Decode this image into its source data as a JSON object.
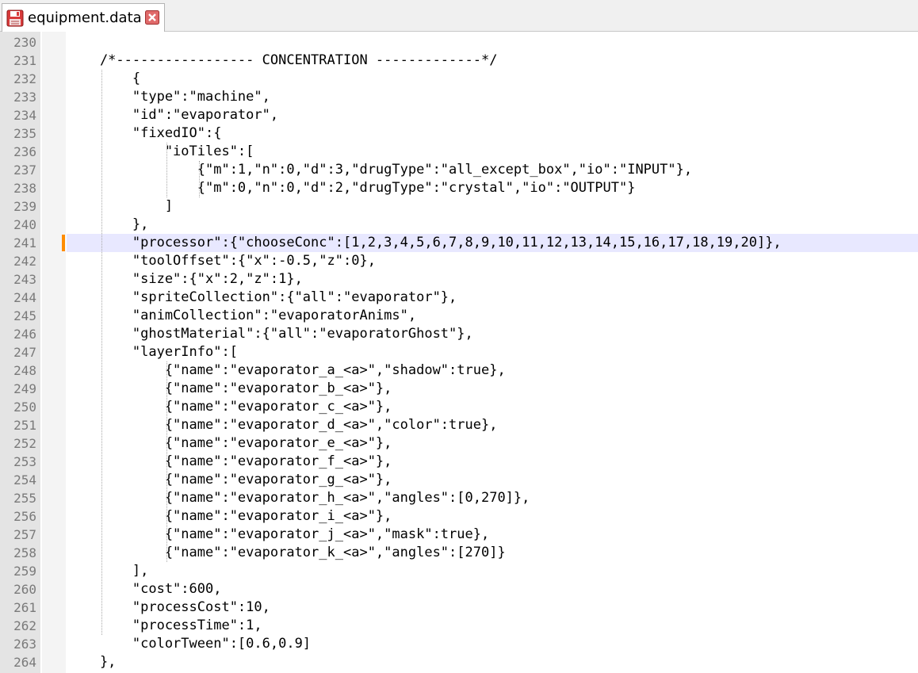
{
  "tab": {
    "file_name": "equipment.data",
    "save_icon": "floppy-disk-icon",
    "close_icon": "close-icon",
    "close_color": "#d02020"
  },
  "editor": {
    "highlight_line": "241",
    "lines": [
      {
        "num": "230",
        "text": ""
      },
      {
        "num": "231",
        "text": "    /*----------------- CONCENTRATION -------------*/"
      },
      {
        "num": "232",
        "text": "        {"
      },
      {
        "num": "233",
        "text": "        \"type\":\"machine\","
      },
      {
        "num": "234",
        "text": "        \"id\":\"evaporator\","
      },
      {
        "num": "235",
        "text": "        \"fixedIO\":{"
      },
      {
        "num": "236",
        "text": "            \"ioTiles\":["
      },
      {
        "num": "237",
        "text": "                {\"m\":1,\"n\":0,\"d\":3,\"drugType\":\"all_except_box\",\"io\":\"INPUT\"},"
      },
      {
        "num": "238",
        "text": "                {\"m\":0,\"n\":0,\"d\":2,\"drugType\":\"crystal\",\"io\":\"OUTPUT\"}"
      },
      {
        "num": "239",
        "text": "            ]"
      },
      {
        "num": "240",
        "text": "        },"
      },
      {
        "num": "241",
        "text": "        \"processor\":{\"chooseConc\":[1,2,3,4,5,6,7,8,9,10,11,12,13,14,15,16,17,18,19,20]},"
      },
      {
        "num": "242",
        "text": "        \"toolOffset\":{\"x\":-0.5,\"z\":0},"
      },
      {
        "num": "243",
        "text": "        \"size\":{\"x\":2,\"z\":1},"
      },
      {
        "num": "244",
        "text": "        \"spriteCollection\":{\"all\":\"evaporator\"},"
      },
      {
        "num": "245",
        "text": "        \"animCollection\":\"evaporatorAnims\","
      },
      {
        "num": "246",
        "text": "        \"ghostMaterial\":{\"all\":\"evaporatorGhost\"},"
      },
      {
        "num": "247",
        "text": "        \"layerInfo\":["
      },
      {
        "num": "248",
        "text": "            {\"name\":\"evaporator_a_<a>\",\"shadow\":true},"
      },
      {
        "num": "249",
        "text": "            {\"name\":\"evaporator_b_<a>\"},"
      },
      {
        "num": "250",
        "text": "            {\"name\":\"evaporator_c_<a>\"},"
      },
      {
        "num": "251",
        "text": "            {\"name\":\"evaporator_d_<a>\",\"color\":true},"
      },
      {
        "num": "252",
        "text": "            {\"name\":\"evaporator_e_<a>\"},"
      },
      {
        "num": "253",
        "text": "            {\"name\":\"evaporator_f_<a>\"},"
      },
      {
        "num": "254",
        "text": "            {\"name\":\"evaporator_g_<a>\"},"
      },
      {
        "num": "255",
        "text": "            {\"name\":\"evaporator_h_<a>\",\"angles\":[0,270]},"
      },
      {
        "num": "256",
        "text": "            {\"name\":\"evaporator_i_<a>\"},"
      },
      {
        "num": "257",
        "text": "            {\"name\":\"evaporator_j_<a>\",\"mask\":true},"
      },
      {
        "num": "258",
        "text": "            {\"name\":\"evaporator_k_<a>\",\"angles\":[270]}"
      },
      {
        "num": "259",
        "text": "        ],"
      },
      {
        "num": "260",
        "text": "        \"cost\":600,"
      },
      {
        "num": "261",
        "text": "        \"processCost\":10,"
      },
      {
        "num": "262",
        "text": "        \"processTime\":1,"
      },
      {
        "num": "263",
        "text": "        \"colorTween\":[0.6,0.9]"
      },
      {
        "num": "264",
        "text": "    },"
      }
    ]
  },
  "colors": {
    "gutter_bg": "#e4e4e4",
    "current_line_bg": "#e8e8ff",
    "change_marker": "#ff8c00",
    "line_number": "#7a7a7a"
  }
}
